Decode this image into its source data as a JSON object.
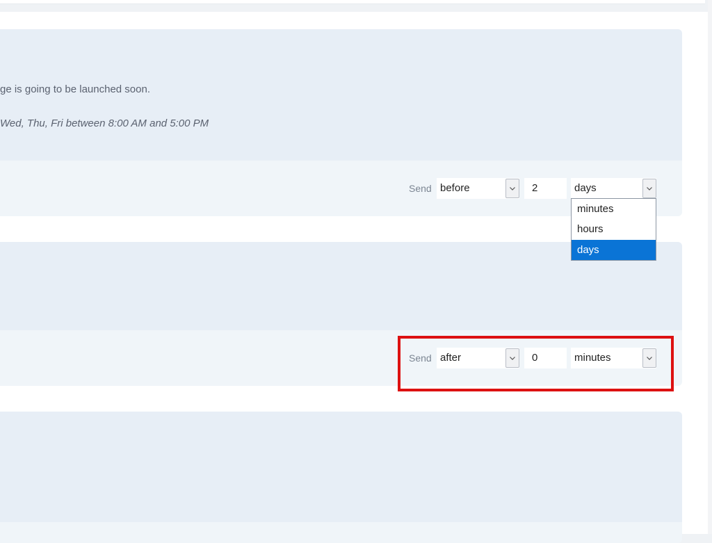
{
  "messages": [
    {
      "text": "ge is going to be launched soon.",
      "schedule": "Wed, Thu, Fri between 8:00 AM and 5:00 PM",
      "send_label": "Send",
      "direction": "before",
      "amount": "2",
      "unit": "days"
    },
    {
      "send_label": "Send",
      "direction": "after",
      "amount": "0",
      "unit": "minutes"
    }
  ],
  "unit_dropdown": {
    "options": [
      "minutes",
      "hours",
      "days"
    ],
    "selected": "days"
  },
  "highlight_color": "#dd1111",
  "accent_color": "#0a74d6"
}
